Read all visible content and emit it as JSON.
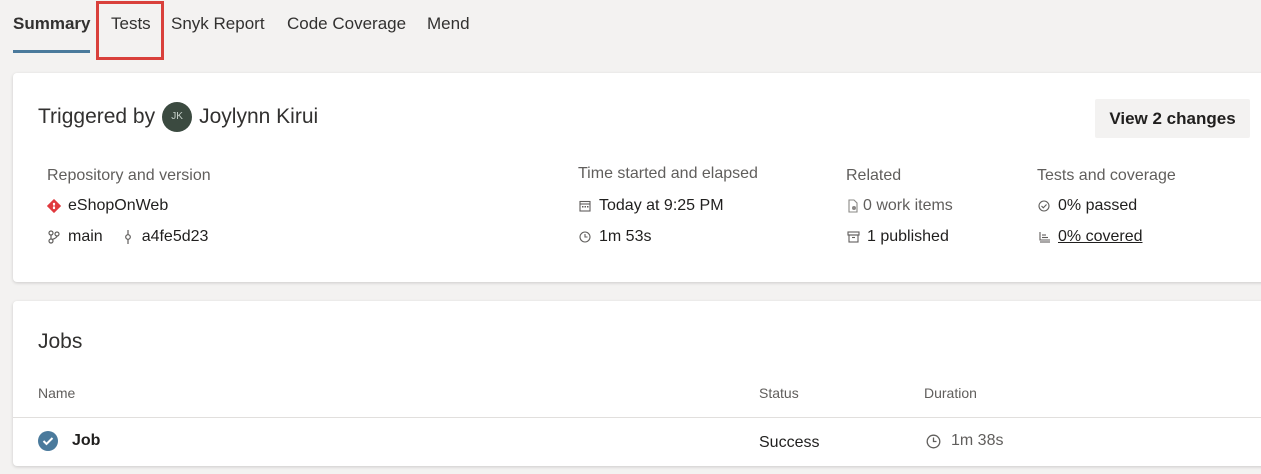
{
  "tabs": [
    {
      "label": "Summary",
      "active": true
    },
    {
      "label": "Tests",
      "highlighted": true
    },
    {
      "label": "Snyk Report"
    },
    {
      "label": "Code Coverage"
    },
    {
      "label": "Mend"
    }
  ],
  "summary": {
    "triggered_prefix": "Triggered by",
    "avatar_initials": "JK",
    "user_name": "Joylynn Kirui",
    "view_changes_label": "View 2 changes",
    "repository": {
      "heading": "Repository and version",
      "repo_name": "eShopOnWeb",
      "branch": "main",
      "commit": "a4fe5d23"
    },
    "time": {
      "heading": "Time started and elapsed",
      "started": "Today at 9:25 PM",
      "elapsed": "1m 53s"
    },
    "related": {
      "heading": "Related",
      "work_items": "0 work items",
      "published": "1 published"
    },
    "tests": {
      "heading": "Tests and coverage",
      "passed": "0% passed",
      "covered": "0% covered"
    }
  },
  "jobs": {
    "title": "Jobs",
    "columns": {
      "name": "Name",
      "status": "Status",
      "duration": "Duration"
    },
    "rows": [
      {
        "name": "Job",
        "status": "Success",
        "duration": "1m 38s"
      }
    ]
  },
  "colors": {
    "accent": "#4a7a9c",
    "highlight": "#d9403b",
    "git": "#e0393e"
  }
}
